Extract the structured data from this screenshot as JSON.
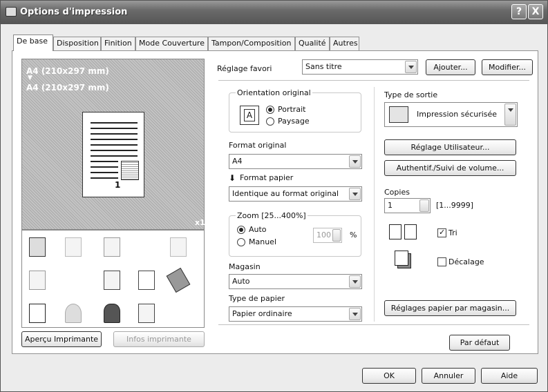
{
  "window": {
    "title": "Options d'impression",
    "help_button": "?",
    "close_button": "X"
  },
  "tabs": [
    {
      "label": "De base",
      "active": true
    },
    {
      "label": "Disposition"
    },
    {
      "label": "Finition"
    },
    {
      "label": "Mode Couverture"
    },
    {
      "label": "Tampon/Composition"
    },
    {
      "label": "Qualité"
    },
    {
      "label": "Autres"
    }
  ],
  "preview": {
    "line1": "A4 (210x297 mm)",
    "arrow": "▼",
    "line2": "A4 (210x297 mm)",
    "page_number": "1",
    "copies_marker": "x1"
  },
  "bottom_left": {
    "preview_button": "Aperçu Imprimante",
    "printer_info_button": "Infos imprimante"
  },
  "favorite": {
    "label": "Réglage favori",
    "value": "Sans titre",
    "add_button": "Ajouter...",
    "modify_button": "Modifier..."
  },
  "orientation": {
    "group_title": "Orientation original",
    "portrait": "Portrait",
    "landscape": "Paysage",
    "selected": "portrait",
    "icon_letter": "A"
  },
  "original_format": {
    "label": "Format original",
    "value": "A4"
  },
  "paper_format": {
    "label": "Format papier",
    "value": "Identique au format original"
  },
  "zoom": {
    "group_title": "Zoom [25...400%]",
    "auto": "Auto",
    "manual": "Manuel",
    "selected": "auto",
    "value": "100",
    "unit": "%"
  },
  "tray": {
    "label": "Magasin",
    "value": "Auto"
  },
  "paper_type": {
    "label": "Type de papier",
    "value": "Papier ordinaire"
  },
  "output": {
    "label": "Type de sortie",
    "value": "Impression sécurisée"
  },
  "user_settings_button": "Réglage Utilisateur...",
  "auth_button": "Authentif./Suivi de volume...",
  "copies": {
    "label": "Copies",
    "value": "1",
    "range": "[1...9999]"
  },
  "collate": {
    "label": "Tri",
    "checked": true
  },
  "offset": {
    "label": "Décalage",
    "checked": false
  },
  "tray_paper_button": "Réglages papier par magasin...",
  "default_button": "Par défaut",
  "footer": {
    "ok": "OK",
    "cancel": "Annuler",
    "help": "Aide"
  }
}
